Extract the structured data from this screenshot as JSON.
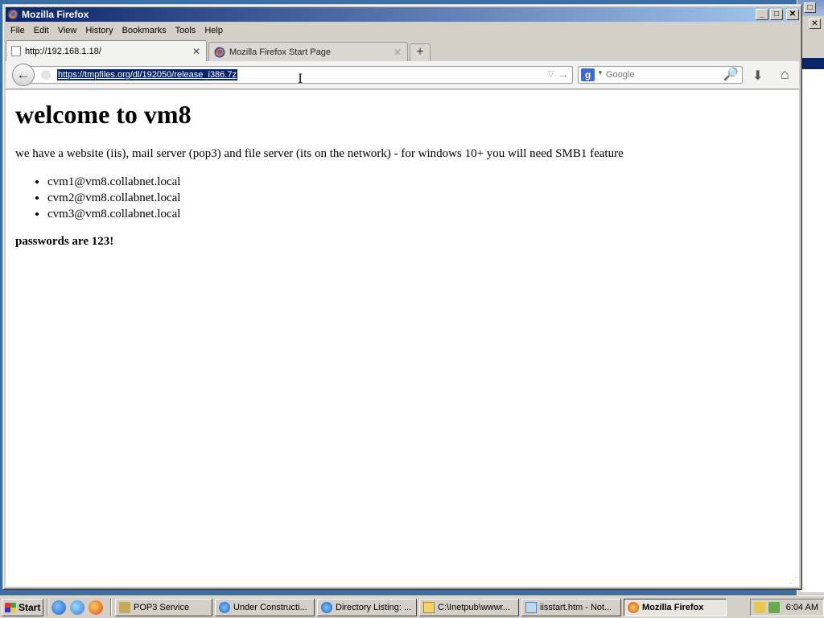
{
  "window": {
    "title": "Mozilla Firefox",
    "minimize": "_",
    "maximize": "□",
    "close": "✕"
  },
  "menu": [
    "File",
    "Edit",
    "View",
    "History",
    "Bookmarks",
    "Tools",
    "Help"
  ],
  "tabs": [
    {
      "label": "http://192.168.1.18/",
      "close": "✕"
    },
    {
      "label": "Mozilla Firefox Start Page",
      "close": "✕"
    }
  ],
  "new_tab": "+",
  "navbar": {
    "back": "←",
    "url": "https://tmpfiles.org/dl/192050/release_i386.7z",
    "dropdown": "▽",
    "go": "→",
    "cursor": "I",
    "search_engine": "g",
    "search_placeholder": "Google",
    "search_icon": "🔎",
    "download": "⬇",
    "home": "⌂"
  },
  "page": {
    "heading": "welcome to vm8",
    "intro": "we have a website (iis), mail server (pop3) and file server (its on the network) - for windows 10+ you will need SMB1 feature",
    "accounts": [
      "cvm1@vm8.collabnet.local",
      "cvm2@vm8.collabnet.local",
      "cvm3@vm8.collabnet.local"
    ],
    "passwords": "passwords are 123!"
  },
  "taskbar": {
    "start": "Start",
    "tasks": [
      "POP3 Service",
      "Under Constructi...",
      "Directory Listing: ...",
      "C:\\Inetpub\\wwwr...",
      "iisstart.htm - Not...",
      "Mozilla Firefox"
    ],
    "clock": "6:04 AM"
  },
  "colors": {
    "titlebar_start": "#0a246a",
    "titlebar_end": "#a6caf0",
    "selection": "#0a246a",
    "chrome": "#d4d0c8"
  }
}
